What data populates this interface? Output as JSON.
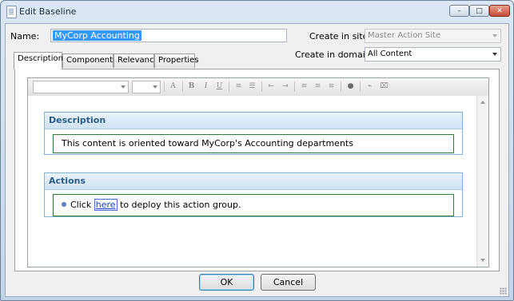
{
  "window": {
    "title": "Edit Baseline",
    "controls": {
      "minimize": "–",
      "maximize": "□",
      "close": "✕"
    }
  },
  "form": {
    "name_label": "Name:",
    "name_value": "MyCorp Accounting",
    "site_label": "Create in site:",
    "site_value": "Master Action Site",
    "domain_label": "Create in domain:",
    "domain_value": "All Content"
  },
  "tabs": [
    {
      "label": "Description",
      "active": true
    },
    {
      "label": "Components",
      "active": false
    },
    {
      "label": "Relevance",
      "active": false
    },
    {
      "label": "Properties",
      "active": false
    }
  ],
  "toolbar": {
    "buttons": [
      "font-color-icon",
      "bold-icon",
      "italic-icon",
      "underline-icon",
      "numbered-list-icon",
      "bulleted-list-icon",
      "outdent-icon",
      "indent-icon",
      "align-left-icon",
      "align-center-icon",
      "align-right-icon",
      "link-icon",
      "clear-format-icon",
      "html-source-icon"
    ]
  },
  "editor": {
    "description": {
      "heading": "Description",
      "text": "This content is oriented toward MyCorp's Accounting departments"
    },
    "actions": {
      "heading": "Actions",
      "prefix": "Click ",
      "link": "here",
      "suffix": " to deploy this action group."
    }
  },
  "buttons": {
    "ok": "OK",
    "cancel": "Cancel"
  }
}
